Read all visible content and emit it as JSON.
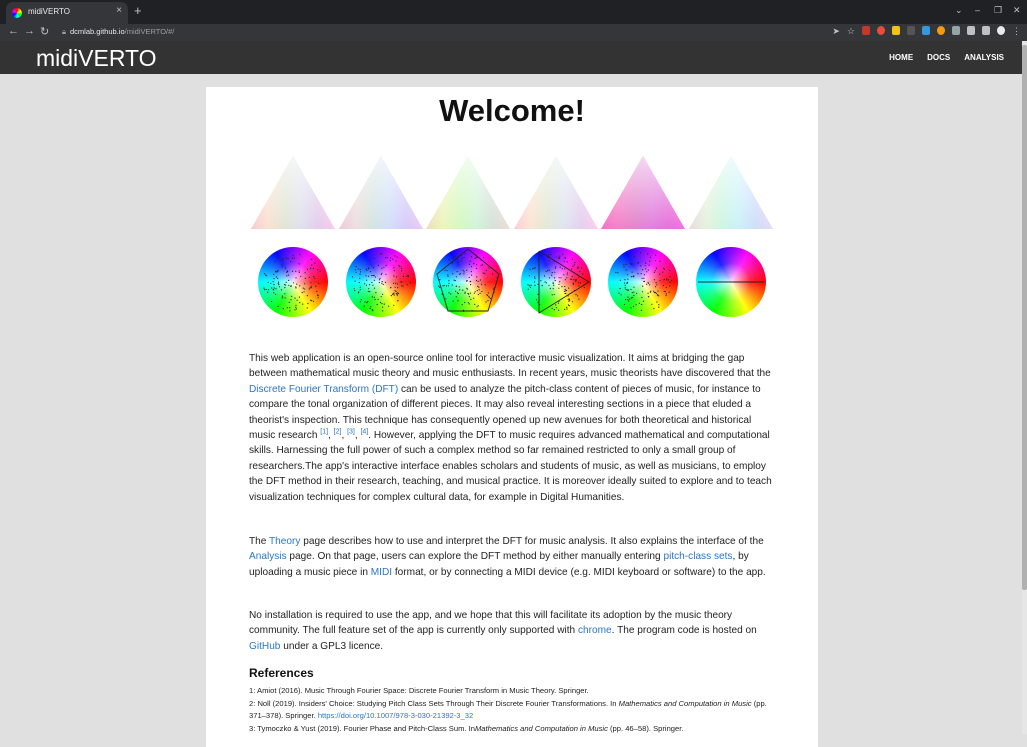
{
  "browser": {
    "tab_title": "midiVERTO",
    "tab_close": "×",
    "new_tab": "+",
    "url_host": "dcmlab.github.io",
    "url_path": "/midiVERTO/#/",
    "win_controls": [
      "⌄",
      "–",
      "❐",
      "✕"
    ],
    "nav": [
      "←",
      "→",
      "↻"
    ]
  },
  "site": {
    "brand": "midiVERTO",
    "menu": [
      "HOME",
      "DOCS",
      "ANALYSIS"
    ]
  },
  "main": {
    "heading": "Welcome!",
    "p1": {
      "a": "This web application is an open-source online tool for interactive music visualization. It aims at bridging the gap between mathematical music theory and music enthusiasts. In recent years, music theorists have discovered that the ",
      "dft_link": "Discrete Fourier Transform (DFT)",
      "b": " can be used to analyze the pitch-class content of pieces of music, for instance to compare the tonal organization of different pieces. It may also reveal interesting sections in a piece that eluded a theorist's inspection. This technique has consequently opened up new avenues for both theoretical and historical music research ",
      "cites": [
        "[1]",
        "[2]",
        "[3]",
        "[4]"
      ],
      "c": ". However, applying the DFT to music requires advanced mathematical and computational skills. Harnessing the full power of such a complex method so far remained restricted to only a small group of researchers.The app's interactive interface enables scholars and students of music, as well as musicians, to employ the DFT method in their research, teaching, and musical practice. It is moreover ideally suited to explore and to teach visualization techniques for complex cultural data, for example in Digital Humanities."
    },
    "p2": {
      "a": "The ",
      "theory_link": "Theory",
      "b": " page describes how to use and interpret the DFT for music analysis. It also explains the interface of the ",
      "analysis_link": "Analysis",
      "c": " page. On that page, users can explore the DFT method by either manually entering ",
      "pcs_link": "pitch-class sets",
      "d": ", by uploading a music piece in ",
      "midi_link": "MIDI",
      "e": " format, or by connecting a MIDI device (e.g. MIDI keyboard or software) to the app."
    },
    "p3": {
      "a": "No installation is required to use the app, and we hope that this will facilitate its adoption by the music theory community. The full feature set of the app is currently only supported with ",
      "chrome_link": "chrome",
      "b": ". The program code is hosted on ",
      "github_link": "GitHub",
      "c": " under a GPL3 licence."
    },
    "refs_heading": "References",
    "refs": {
      "r1": "1: Amiot (2016). Music Through Fourier Space: Discrete Fourier Transform in Music Theory. Springer.",
      "r2a": "2: Noll (2019). Insiders' Choice: Studying Pitch Class Sets Through Their Discrete Fourier Transformations. In ",
      "r2i": "Mathematics and Computation in Music",
      "r2b": " (pp. 371–378). Springer. ",
      "r2link": "https://doi.org/10.1007/978-3-030-21392-3_32",
      "r3a": "3: Tymoczko & Yust (2019). Fourier Phase and Pitch-Class Sum. In",
      "r3i": "Mathematics and Computation in Music",
      "r3b": " (pp. 46–58). Springer."
    }
  },
  "colors": {
    "navbar": "#333333",
    "link": "#2a76c6",
    "triangle_tints": [
      "#f4c8d8",
      "#d8c4f4",
      "#d6f2a8",
      "#f6cfdc",
      "#f25ad0",
      "#c8ecf4"
    ]
  }
}
